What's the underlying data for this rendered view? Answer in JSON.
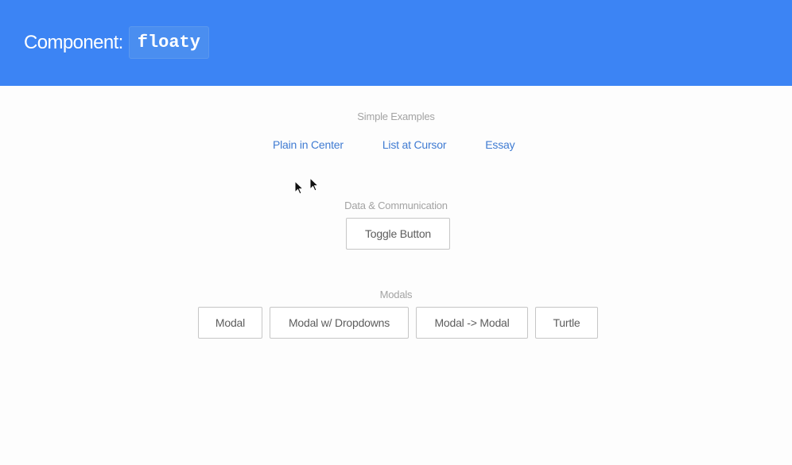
{
  "header": {
    "title_prefix": "Component:",
    "component_name": "floaty",
    "background_color": "#3c84f4"
  },
  "sections": {
    "simple": {
      "title": "Simple Examples",
      "links": [
        "Plain in Center",
        "List at Cursor",
        "Essay"
      ]
    },
    "data": {
      "title": "Data & Communication",
      "button": "Toggle Button"
    },
    "modals": {
      "title": "Modals",
      "buttons": [
        "Modal",
        "Modal w/ Dropdowns",
        "Modal -> Modal",
        "Turtle"
      ]
    }
  },
  "colors": {
    "link": "#3f7bd2",
    "section_title": "#a3a3a3",
    "button_border": "#c6c6c6"
  },
  "icons": [
    "mouse-pointer-icon",
    "mouse-pointer-icon"
  ]
}
